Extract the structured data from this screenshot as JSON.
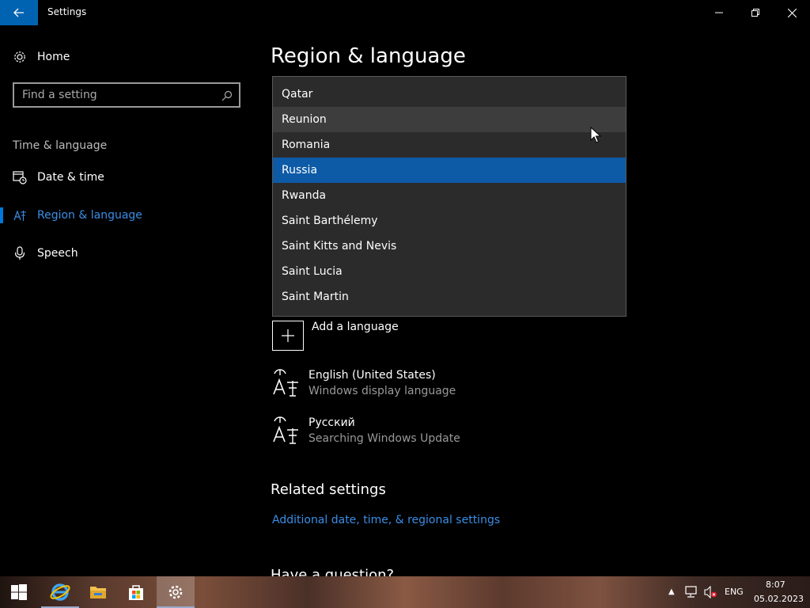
{
  "window": {
    "title": "Settings"
  },
  "sidebar": {
    "home_label": "Home",
    "search_placeholder": "Find a setting",
    "group_label": "Time & language",
    "items": [
      {
        "label": "Date & time",
        "icon": "date-time-icon"
      },
      {
        "label": "Region & language",
        "icon": "region-language-icon",
        "active": true
      },
      {
        "label": "Speech",
        "icon": "microphone-icon"
      }
    ]
  },
  "main": {
    "title": "Region & language",
    "country_options": [
      "Qatar",
      "Reunion",
      "Romania",
      "Russia",
      "Rwanda",
      "Saint Barthélemy",
      "Saint Kitts and Nevis",
      "Saint Lucia",
      "Saint Martin"
    ],
    "hovered_option": "Reunion",
    "selected_option": "Russia",
    "add_language_label": "Add a language",
    "languages": [
      {
        "name": "English (United States)",
        "status": "Windows display language"
      },
      {
        "name": "Русский",
        "status": "Searching Windows Update"
      }
    ],
    "related_heading": "Related settings",
    "related_link": "Additional date, time, & regional settings",
    "question_heading": "Have a question?"
  },
  "taskbar": {
    "apps": [
      "start-icon",
      "internet-explorer-icon",
      "file-explorer-icon",
      "store-icon",
      "settings-icon"
    ],
    "language": "ENG",
    "time": "8:07",
    "date": "05.02.2023"
  },
  "colors": {
    "accent": "#0078d7",
    "selected": "#0d5aa7",
    "link": "#3a8ee6"
  }
}
